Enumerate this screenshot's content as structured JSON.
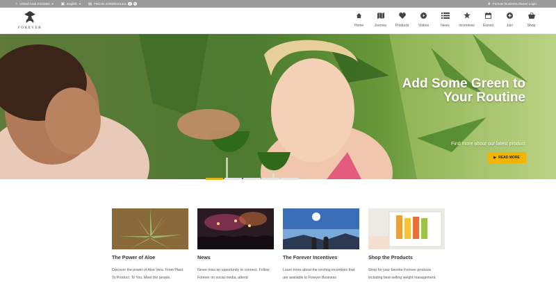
{
  "topbar": {
    "country": "United Arab Emirates",
    "language": "English",
    "fbo_id": "FBO ID 440000101411",
    "owner_login": "Forever Business Owner Login"
  },
  "logo": {
    "text": "FOREVER"
  },
  "nav": [
    {
      "label": "Home",
      "icon": "home-icon"
    },
    {
      "label": "Journey",
      "icon": "map-icon"
    },
    {
      "label": "Products",
      "icon": "heart-icon"
    },
    {
      "label": "Videos",
      "icon": "play-icon"
    },
    {
      "label": "News",
      "icon": "news-icon"
    },
    {
      "label": "Incentives",
      "icon": "star-icon"
    },
    {
      "label": "Events",
      "icon": "calendar-icon"
    },
    {
      "label": "Join",
      "icon": "plus-icon"
    },
    {
      "label": "Shop",
      "icon": "basket-icon"
    }
  ],
  "hero": {
    "title": "Add Some Green to Your Routine",
    "subtitle": "Find more about our latest product",
    "button_label": "READ MORE",
    "slides_count": 5,
    "active_slide": 1
  },
  "cards": [
    {
      "title": "The Power of Aloe",
      "desc": "Discover the power of Aloe Vera. From Plant. To Product. To You. Meet the people,"
    },
    {
      "title": "News",
      "desc": "Never miss an opportunity to connect. Follow Forever on social media, attend"
    },
    {
      "title": "The Forever Incentives",
      "desc": "Learn more about the exciting incentives that are available to Forever Business"
    },
    {
      "title": "Shop the Products",
      "desc": "Shop for your favorite Forever products including best-selling weight management,"
    }
  ],
  "colors": {
    "accent": "#f2b400",
    "topbar": "#9a9a9a"
  }
}
